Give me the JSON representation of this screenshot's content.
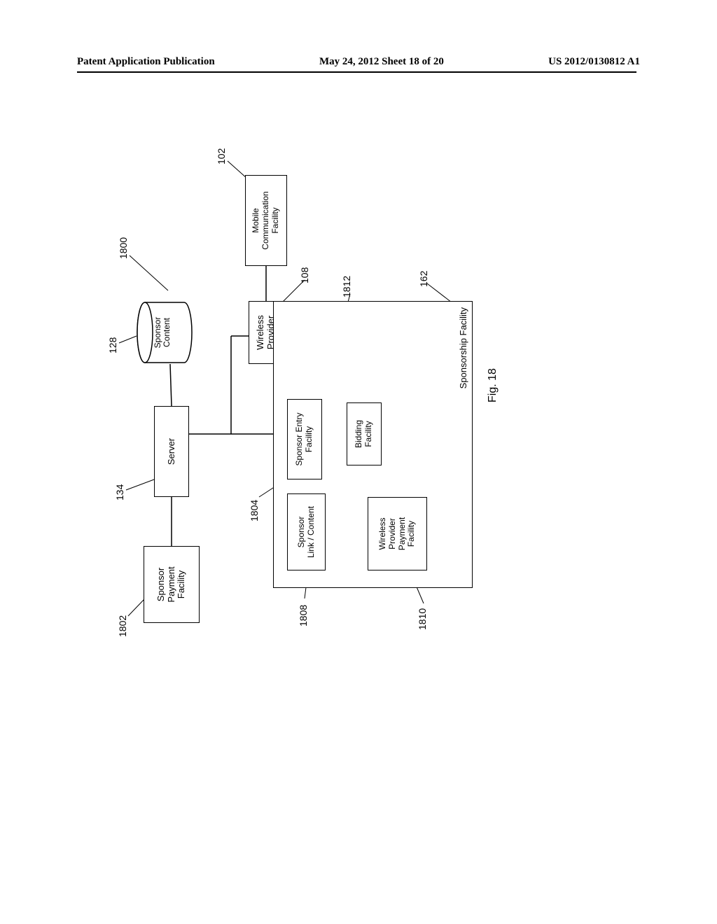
{
  "header": {
    "left": "Patent Application Publication",
    "center": "May 24, 2012  Sheet 18 of 20",
    "right": "US 2012/0130812 A1"
  },
  "figure_label": "Fig. 18",
  "refs": {
    "r1800": "1800",
    "r128": "128",
    "r134": "134",
    "r1802": "1802",
    "r102": "102",
    "r108": "108",
    "r1804": "1804",
    "r1808": "1808",
    "r1810": "1810",
    "r1812": "1812",
    "r162": "162"
  },
  "boxes": {
    "sponsor_payment": "Sponsor\nPayment\nFacility",
    "server": "Server",
    "sponsor_content": "Sponsor\nContent",
    "wireless_provider": "Wireless\nProvider",
    "mobile_comm": "Mobile\nCommunication\nFacility",
    "sponsorship_facility": "Sponsorship Facility",
    "sponsor_link": "Sponsor\nLink / Content",
    "sponsor_entry": "Sponsor Entry\nFacility",
    "bidding": "Bidding\nFacility",
    "wireless_payment": "Wireless\nProvider\nPayment\nFacility"
  }
}
